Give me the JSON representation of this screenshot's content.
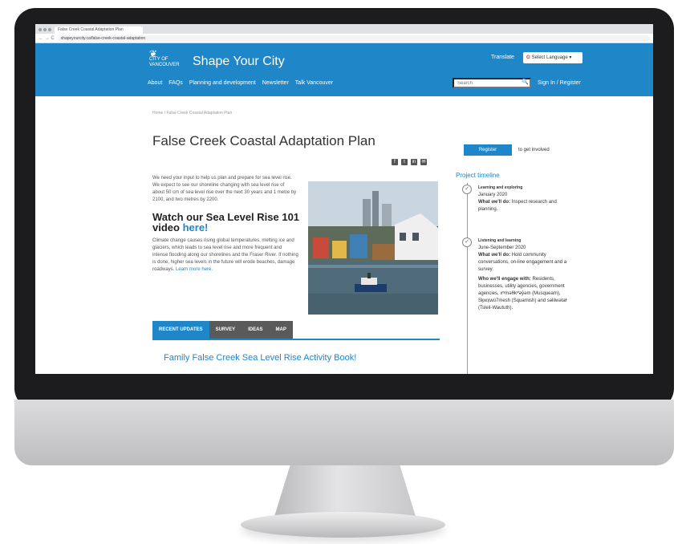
{
  "browser": {
    "tab_title": "False Creek Coastal Adaptation Plan",
    "nav_buttons": "← → C",
    "url": "shapeyourcity.ca/false-creek-coastal-adaptation"
  },
  "header": {
    "logo_line1": "CITY OF",
    "logo_line2": "VANCOUVER",
    "site_title": "Shape Your City",
    "translate": "Translate",
    "language_select": "Select Language",
    "search_placeholder": "Search",
    "sign_in": "Sign In / Register",
    "nav": [
      "About",
      "FAQs",
      "Planning and development",
      "Newsletter",
      "Talk Vancouver"
    ]
  },
  "content": {
    "breadcrumb": "Home / False Creek Coastal Adaptation Plan",
    "page_title": "False Creek Coastal Adaptation Plan",
    "intro": "We need your input to help us plan and prepare for sea level rise. We expect to see our shoreline changing with sea level rise of about 50 cm of sea level rise over the next 30 years and 1 metre by 2100, and two metres by 2200.",
    "watch_title": "Watch our Sea Level Rise 101 video",
    "watch_link": "here!",
    "body": "Climate change causes rising global temperatures, melting ice and glaciers, which leads to sea level rise and more frequent and intense flooding along our shorelines and the Fraser River. If nothing is done, higher sea levels in the future will erode beaches, damage roadways.",
    "body_link": "Learn more here.",
    "tabs": [
      "RECENT UPDATES",
      "SURVEY",
      "IDEAS",
      "MAP"
    ],
    "update_title": "Family False Creek Sea Level Rise Activity Book!"
  },
  "sidebar": {
    "register": "Register",
    "get_involved": "to get involved",
    "timeline_title": "Project timeline",
    "stages": [
      {
        "title": "Learning and exploring",
        "date": "January 2020",
        "label": "What we'll do:",
        "text": "Inspect research and planning."
      },
      {
        "title": "Listening and learning",
        "date": "June-September 2020",
        "label": "What we'll do:",
        "text": "Hold community conversations, on-line engagement and a survey.",
        "label2": "Who we'll engage with:",
        "text2": "Residents, businesses, utility agencies, government agencies, xʷməθkʷəy̓əm (Musqueam), Sḵwx̱wú7mesh (Squamish) and səlilwətaɬ (Tsleil-Waututh)."
      }
    ]
  },
  "colors": {
    "brand_blue": "#1f86c8",
    "tab_grey": "#5a5a5a"
  }
}
